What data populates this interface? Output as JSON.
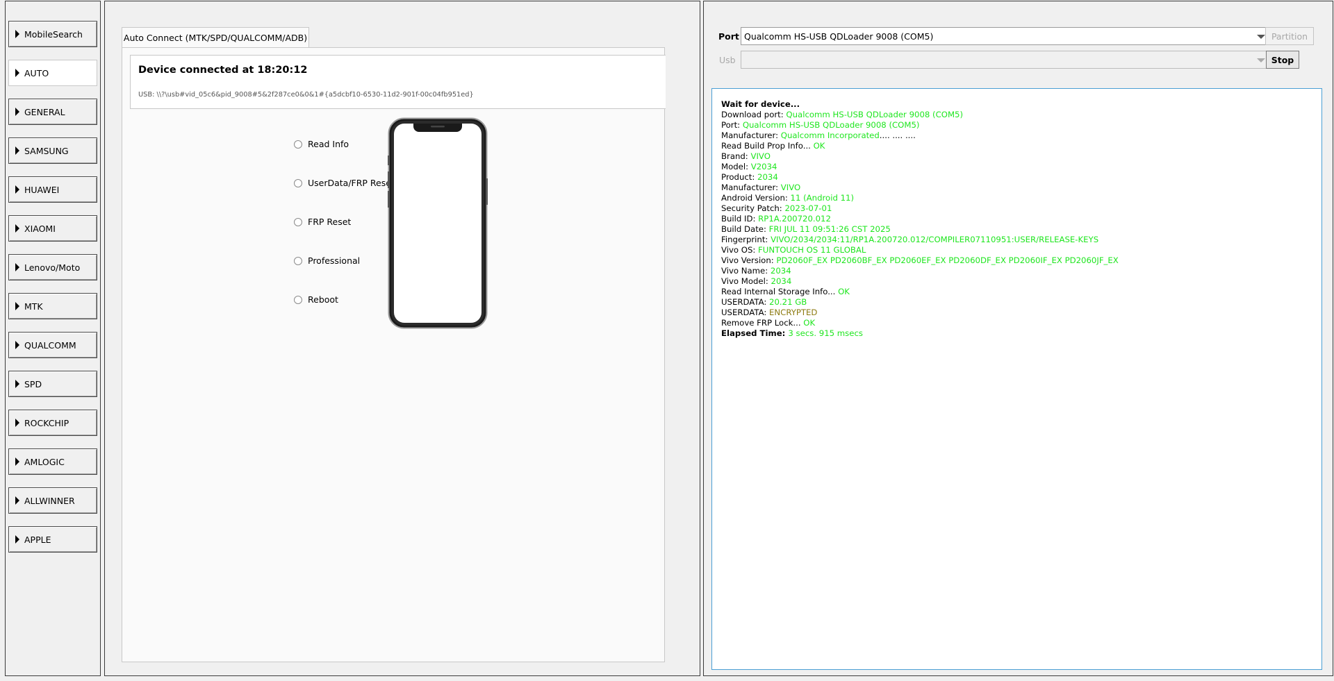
{
  "sidebar": {
    "items": [
      {
        "label": "MobileSearch"
      },
      {
        "label": "AUTO"
      },
      {
        "label": "GENERAL"
      },
      {
        "label": "SAMSUNG"
      },
      {
        "label": "HUAWEI"
      },
      {
        "label": "XIAOMI"
      },
      {
        "label": "Lenovo/Moto"
      },
      {
        "label": "MTK"
      },
      {
        "label": "QUALCOMM"
      },
      {
        "label": "SPD"
      },
      {
        "label": "ROCKCHIP"
      },
      {
        "label": "AMLOGIC"
      },
      {
        "label": "ALLWINNER"
      },
      {
        "label": "APPLE"
      }
    ]
  },
  "center": {
    "tab_label": "Auto Connect (MTK/SPD/QUALCOMM/ADB)",
    "status_title": "Device connected at 18:20:12",
    "status_usb": "USB: \\\\?\\usb#vid_05c6&pid_9008#5&2f287ce0&0&1#{a5dcbf10-6530-11d2-901f-00c04fb951ed}",
    "options": [
      {
        "label": "Read Info"
      },
      {
        "label": "UserData/FRP Reset"
      },
      {
        "label": "FRP Reset"
      },
      {
        "label": "Professional"
      },
      {
        "label": "Reboot"
      }
    ]
  },
  "right": {
    "port_label": "Port",
    "port_value": "Qualcomm HS-USB QDLoader 9008 (COM5)",
    "usb_label": "Usb",
    "usb_value": "",
    "partition_button": "Partition",
    "stop_button": "Stop"
  },
  "log": [
    {
      "k": "Wait for device...",
      "v": "",
      "bold": true
    },
    {
      "k": "Download port: ",
      "v": "Qualcomm HS-USB QDLoader 9008 (COM5)"
    },
    {
      "k": "Port: ",
      "v": "Qualcomm HS-USB QDLoader 9008 (COM5)"
    },
    {
      "k": "Manufacturer: ",
      "v": "Qualcomm Incorporated",
      "tail": ".... .... ...."
    },
    {
      "k": "Read Build Prop Info... ",
      "v": "OK"
    },
    {
      "k": " Brand: ",
      "v": "VIVO"
    },
    {
      "k": " Model: ",
      "v": "V2034"
    },
    {
      "k": " Product: ",
      "v": "2034"
    },
    {
      "k": " Manufacturer: ",
      "v": "VIVO"
    },
    {
      "k": " Android Version: ",
      "v": "11 (Android 11)"
    },
    {
      "k": " Security Patch: ",
      "v": "2023-07-01"
    },
    {
      "k": " Build ID: ",
      "v": "RP1A.200720.012"
    },
    {
      "k": " Build Date: ",
      "v": "FRI JUL 11 09:51:26 CST 2025"
    },
    {
      "k": " Fingerprint: ",
      "v": "VIVO/2034/2034:11/RP1A.200720.012/COMPILER07110951:USER/RELEASE-KEYS"
    },
    {
      "k": " Vivo OS: ",
      "v": "FUNTOUCH OS 11 GLOBAL"
    },
    {
      "k": " Vivo Version: ",
      "v": "PD2060F_EX PD2060BF_EX PD2060EF_EX PD2060DF_EX PD2060IF_EX PD2060JF_EX"
    },
    {
      "k": " Vivo Name: ",
      "v": "2034"
    },
    {
      "k": " Vivo Model: ",
      "v": "2034"
    },
    {
      "k": "Read Internal Storage Info... ",
      "v": "OK"
    },
    {
      "k": "USERDATA: ",
      "v": "20.21 GB"
    },
    {
      "k": "USERDATA: ",
      "v": "ENCRYPTED",
      "warn": true
    },
    {
      "k": "Remove FRP Lock... ",
      "v": "OK"
    },
    {
      "k": "Elapsed Time: ",
      "v": "3 secs. 915 msecs",
      "bold": true
    }
  ],
  "colors": {
    "log_value": "#1ee61e",
    "log_warn": "#8c7a10",
    "log_border": "#4a9fd4"
  }
}
